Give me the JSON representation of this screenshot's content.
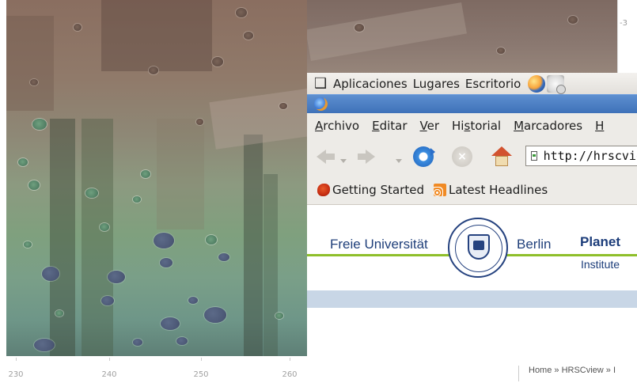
{
  "map": {
    "axis_ticks": [
      "230",
      "240",
      "250",
      "260"
    ],
    "right_tick": "-3"
  },
  "breadcrumb": {
    "text": "Home » HRSCview » I"
  },
  "gnome_panel": {
    "menus": [
      "Aplicaciones",
      "Lugares",
      "Escritorio"
    ],
    "launchers": [
      "firefox-icon",
      "mail-icon"
    ]
  },
  "browser": {
    "menu": [
      {
        "u": "A",
        "rest": "rchivo"
      },
      {
        "u": "E",
        "rest": "ditar"
      },
      {
        "u": "V",
        "rest": "er"
      },
      {
        "pre": "Hi",
        "u": "s",
        "rest": "torial"
      },
      {
        "u": "M",
        "rest": "arcadores"
      },
      {
        "u": "H",
        "rest": ""
      }
    ],
    "url": "http://hrscvie",
    "bookmarks": [
      "Getting Started",
      "Latest Headlines"
    ]
  },
  "page": {
    "university_left": "Freie Universität",
    "university_right": "Berlin",
    "planet_title": "Planet",
    "institute": "Institute"
  },
  "colors": {
    "titlebar": "#4a7fc4",
    "accent_green": "#8fbf2a",
    "band_blue": "#c8d6e6",
    "fu_blue": "#1f3f7a"
  }
}
